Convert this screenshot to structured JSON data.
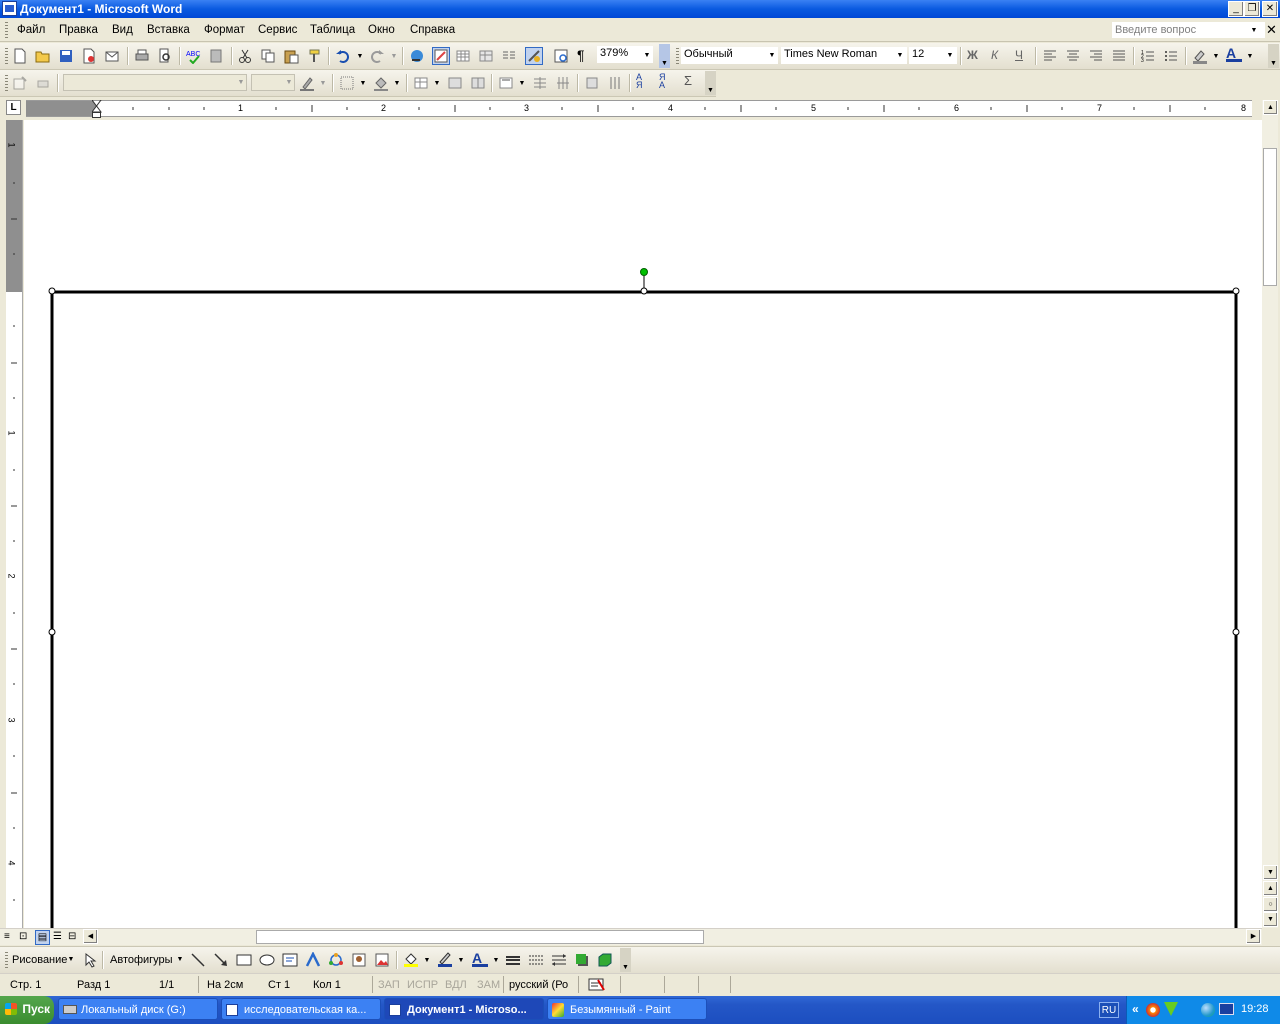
{
  "window": {
    "title": "Документ1 - Microsoft Word"
  },
  "menu": {
    "items": [
      "Файл",
      "Правка",
      "Вид",
      "Вставка",
      "Формат",
      "Сервис",
      "Таблица",
      "Окно",
      "Справка"
    ],
    "ask_placeholder": "Введите вопрос"
  },
  "standard_toolbar": {
    "zoom": "379%",
    "style": "Обычный",
    "font": "Times New Roman",
    "size": "12"
  },
  "ruler": {
    "h_numbers": [
      "1",
      "2",
      "3",
      "4",
      "5",
      "6",
      "7",
      "8"
    ],
    "v_numbers": [
      "1",
      "1",
      "2",
      "3",
      "4"
    ]
  },
  "drawing_toolbar": {
    "draw_label": "Рисование",
    "autoshapes_label": "Автофигуры"
  },
  "status": {
    "page": "Стр. 1",
    "section": "Разд 1",
    "pages": "1/1",
    "at": "На 2см",
    "line": "Ст 1",
    "col": "Кол 1",
    "rec": "ЗАП",
    "trk": "ИСПР",
    "ext": "ВДЛ",
    "ovr": "ЗАМ",
    "lang": "русский (Ро"
  },
  "taskbar": {
    "start": "Пуск",
    "tasks": [
      {
        "label": "Локальный диск (G:)"
      },
      {
        "label": "исследовательская ка..."
      },
      {
        "label": "Документ1 - Microso..."
      },
      {
        "label": "Безымянный - Paint"
      }
    ],
    "lang": "RU",
    "time": "19:28"
  },
  "colors": {
    "titlebar": "#0a5ae0",
    "taskbar": "#245edb",
    "rotate_handle": "#00c000"
  }
}
